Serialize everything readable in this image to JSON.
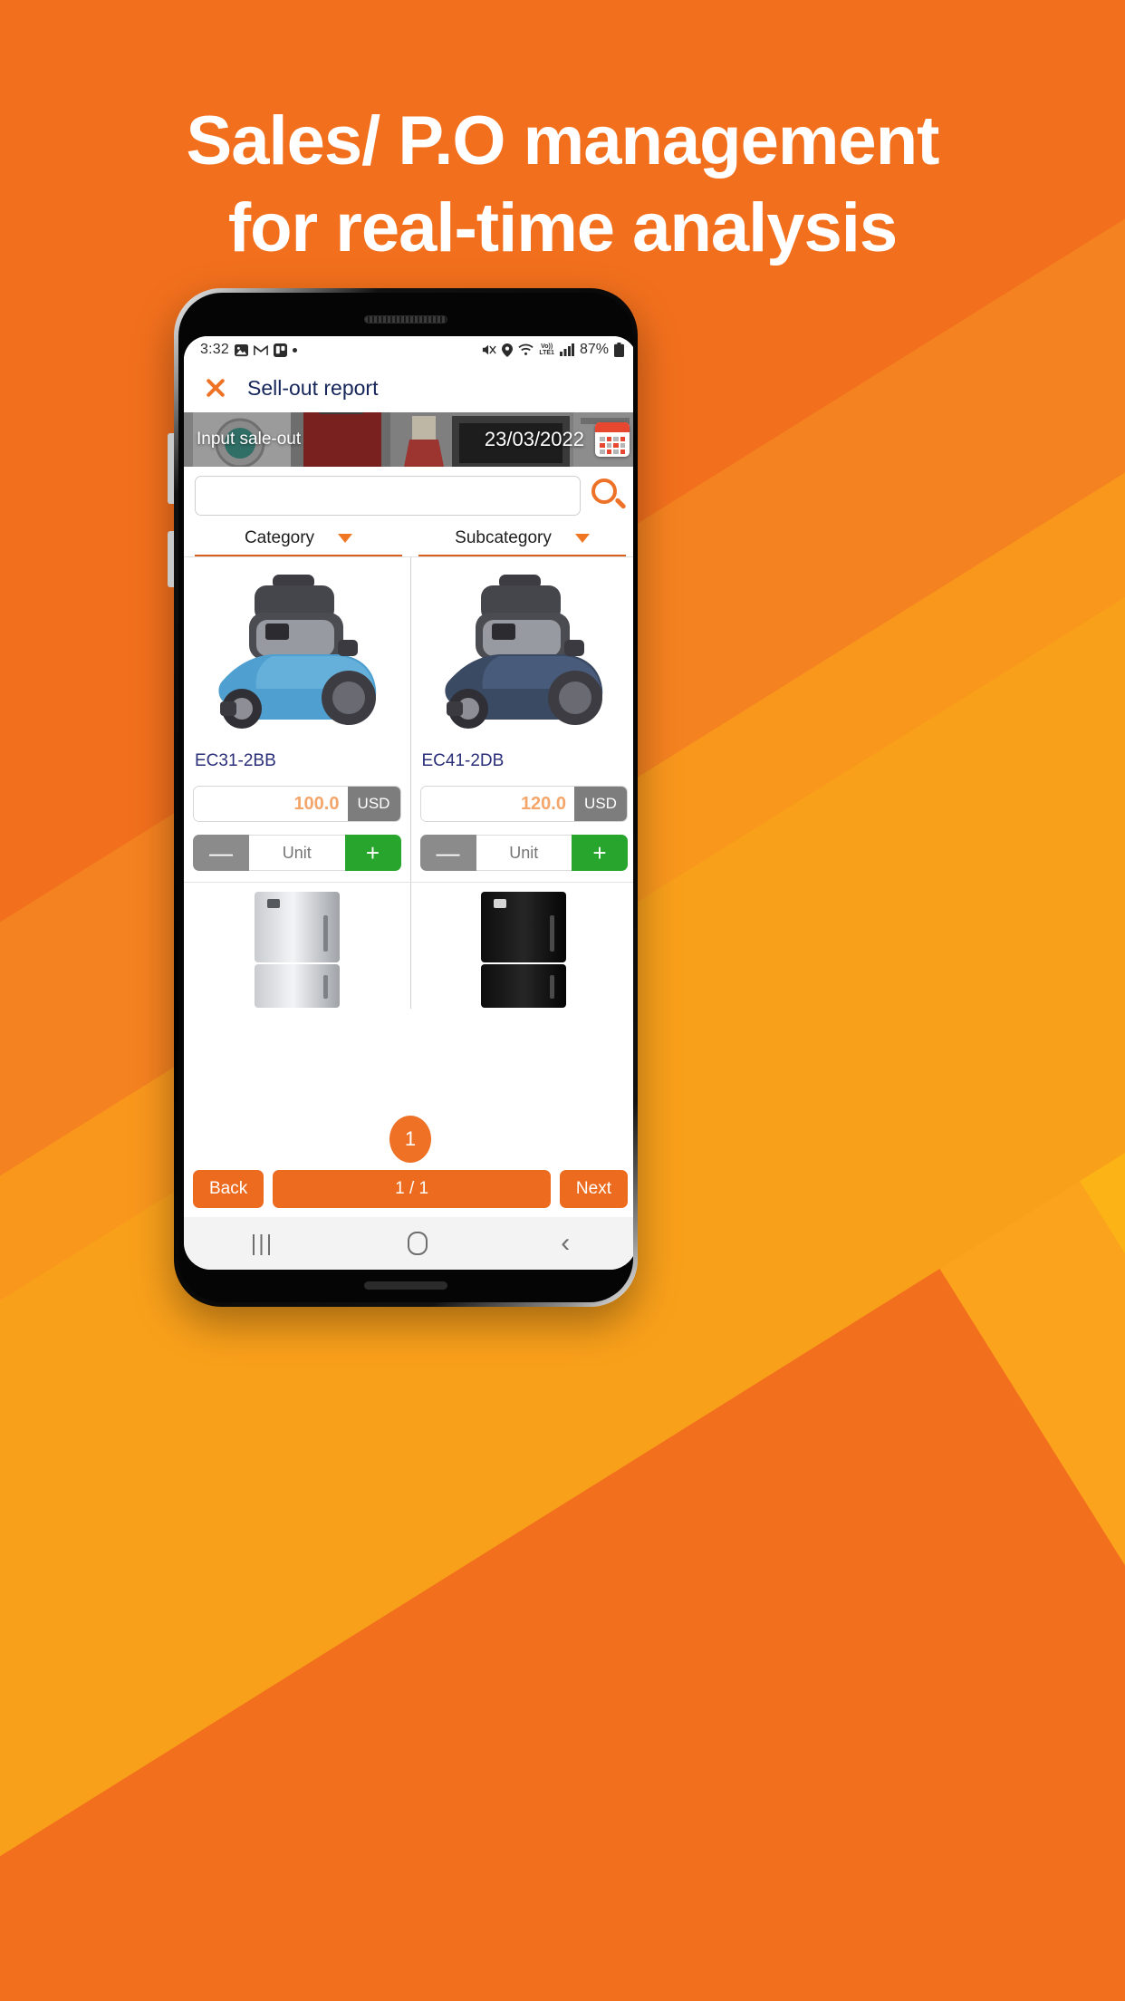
{
  "hero": {
    "line1": "Sales/ P.O management",
    "line2": "for real-time analysis",
    "background_color": "#f2701d",
    "text_color": "#ffffff"
  },
  "status_bar": {
    "time": "3:32",
    "icons_left": [
      "photos-icon",
      "gmail-icon",
      "trello-icon",
      "dot-icon"
    ],
    "mute_icon": "mute-icon",
    "location_icon": "location-icon",
    "wifi_icon": "wifi-icon",
    "network_label": "Vo))",
    "network_type": "LTE1",
    "signal_icon": "signal-bars-icon",
    "battery_percent": "87%",
    "battery_icon": "battery-icon"
  },
  "app_bar": {
    "close_icon": "close-icon",
    "title": "Sell-out report",
    "title_color": "#16265a",
    "accent_color": "#ee7326"
  },
  "banner": {
    "label": "Input sale-out",
    "date": "23/03/2022",
    "calendar_icon": "calendar-icon"
  },
  "search": {
    "value": "",
    "placeholder": "",
    "button_icon": "search-icon"
  },
  "filters": [
    {
      "label": "Category",
      "caret_icon": "chevron-down-icon"
    },
    {
      "label": "Subcategory",
      "caret_icon": "chevron-down-icon"
    }
  ],
  "products": [
    {
      "code": "EC31-2BB",
      "price": "100.0",
      "currency": "USD",
      "unit_placeholder": "Unit",
      "minus_label": "—",
      "plus_label": "+",
      "image": "vacuum-cleaner-blue"
    },
    {
      "code": "EC41-2DB",
      "price": "120.0",
      "currency": "USD",
      "unit_placeholder": "Unit",
      "minus_label": "—",
      "plus_label": "+",
      "image": "vacuum-cleaner-navy"
    }
  ],
  "products_row2": [
    {
      "image": "fridge-silver"
    },
    {
      "image": "fridge-black"
    }
  ],
  "cart_badge": {
    "count": "1",
    "color": "#ee7126"
  },
  "pager": {
    "back_label": "Back",
    "page_label": "1 / 1",
    "next_label": "Next",
    "color": "#ec6b1f"
  },
  "android_nav": {
    "recents_icon": "recents-icon",
    "recents_glyph": "|||",
    "home_icon": "home-icon",
    "back_icon": "back-icon",
    "back_glyph": "‹"
  }
}
